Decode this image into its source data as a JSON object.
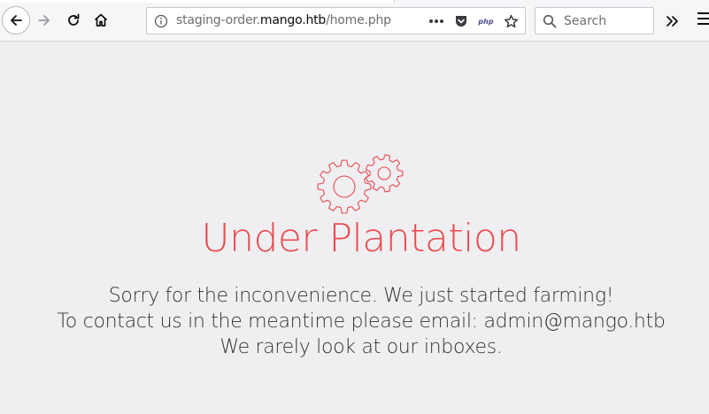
{
  "browser": {
    "url_prefix": "staging-order.",
    "url_host": "mango.htb",
    "url_path": "/home.php",
    "search_placeholder": "Search",
    "page_action_badge": "php"
  },
  "page": {
    "title": "Under Plantation",
    "lines": [
      "Sorry for the inconvenience. We just started farming!",
      "To contact us in the meantime please email: admin@mango.htb",
      "We rarely look at our inboxes."
    ],
    "accent_color": "#ea4c4f",
    "icon": "gears-icon"
  }
}
